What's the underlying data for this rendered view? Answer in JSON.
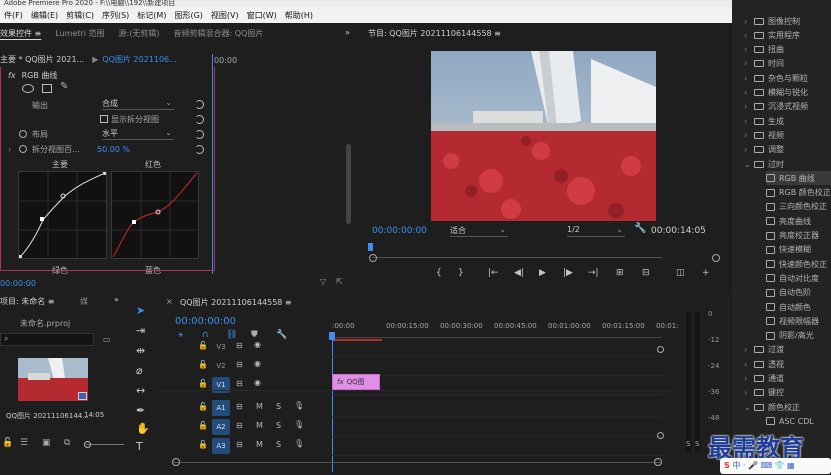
{
  "app_title": "Adobe Premiere Pro 2020 - F:\\\\电脑\\\\192\\\\新建项目",
  "menu": [
    "件(F)",
    "编辑(E)",
    "剪辑(C)",
    "序列(S)",
    "标记(M)",
    "图形(G)",
    "视图(V)",
    "窗口(W)",
    "帮助(H)"
  ],
  "effect_panel": {
    "tabs": [
      "效果控件 ≡",
      "Lumetri 范围",
      "源:(无剪辑)",
      "音频剪辑混合器: QQ图片"
    ],
    "clip_label": "主要 * QQ图片 2021...",
    "clip_target": "QQ图片 2021106...",
    "ruler_time": "00:00",
    "fx_name": "RGB 曲线",
    "output_label": "输出",
    "output_value": "合成",
    "show_split": "显示拆分视图",
    "layout_label": "布局",
    "layout_value": "水平",
    "split_label": "拆分视图百...",
    "split_value": "50.00 %",
    "master_label": "主要",
    "red_label": "红色",
    "green_label": "绿色",
    "blue_label": "蓝色",
    "timecode": "00:00:00"
  },
  "program_monitor": {
    "title": "节目: QQ图片 20211106144558 ≡",
    "timecode": "00:00:00:00",
    "fit": "适合",
    "quality": "1/2",
    "duration": "00:00:14:05"
  },
  "project_panel": {
    "title": "项目: 未命名 ≡",
    "tab2": "媒",
    "project_file": "未命名.prproj",
    "clip_name": "QQ图片 20211106144...",
    "clip_dur": "14:05"
  },
  "timeline": {
    "title": "QQ图片 20211106144558 ≡",
    "timecode": "00:00:00:00",
    "ruler": [
      ":00:00",
      "00:00:15:00",
      "00:00:30:00",
      "00:00:45:00",
      "00:01:00:00",
      "00:01:15:00",
      "00:01:3"
    ],
    "tracks": [
      {
        "label": "V3",
        "active": false
      },
      {
        "label": "V2",
        "active": false
      },
      {
        "label": "V1",
        "active": true
      },
      {
        "label": "A1",
        "active": true
      },
      {
        "label": "A2",
        "active": true
      },
      {
        "label": "A3",
        "active": true
      }
    ],
    "clip_label": "QQ图"
  },
  "meter": {
    "ticks": [
      "0",
      "-12",
      "-24",
      "-36",
      "-48"
    ],
    "labels": [
      "S",
      "S"
    ]
  },
  "effects_tree": [
    {
      "label": "图像控制",
      "type": "folder",
      "open": false
    },
    {
      "label": "实用程序",
      "type": "folder",
      "open": false
    },
    {
      "label": "扭曲",
      "type": "folder",
      "open": false
    },
    {
      "label": "时间",
      "type": "folder",
      "open": false
    },
    {
      "label": "杂色与颗粒",
      "type": "folder",
      "open": false
    },
    {
      "label": "模糊与锐化",
      "type": "folder",
      "open": false
    },
    {
      "label": "沉浸式视频",
      "type": "folder",
      "open": false
    },
    {
      "label": "生成",
      "type": "folder",
      "open": false
    },
    {
      "label": "视频",
      "type": "folder",
      "open": false
    },
    {
      "label": "调整",
      "type": "folder",
      "open": false
    },
    {
      "label": "过时",
      "type": "folder",
      "open": true
    },
    {
      "label": "RGB 曲线",
      "type": "fx",
      "selected": true
    },
    {
      "label": "RGB 颜色校正",
      "type": "fx"
    },
    {
      "label": "三向颜色校正",
      "type": "fx"
    },
    {
      "label": "亮度曲线",
      "type": "fx"
    },
    {
      "label": "亮度校正器",
      "type": "fx"
    },
    {
      "label": "快速模糊",
      "type": "fx"
    },
    {
      "label": "快速颜色校正",
      "type": "fx"
    },
    {
      "label": "自动对比度",
      "type": "fx"
    },
    {
      "label": "自动色阶",
      "type": "fx"
    },
    {
      "label": "自动颜色",
      "type": "fx"
    },
    {
      "label": "视频限幅器",
      "type": "fx"
    },
    {
      "label": "阴影/高光",
      "type": "fx"
    },
    {
      "label": "过渡",
      "type": "folder",
      "open": false
    },
    {
      "label": "透视",
      "type": "folder",
      "open": false
    },
    {
      "label": "通道",
      "type": "folder",
      "open": false
    },
    {
      "label": "键控",
      "type": "folder",
      "open": false
    },
    {
      "label": "颜色校正",
      "type": "folder",
      "open": true
    },
    {
      "label": "ASC CDL",
      "type": "fx"
    }
  ],
  "watermark": {
    "text": "最需教育",
    "ime": "中 · 🎤 ⌨ 👕 ▦"
  }
}
